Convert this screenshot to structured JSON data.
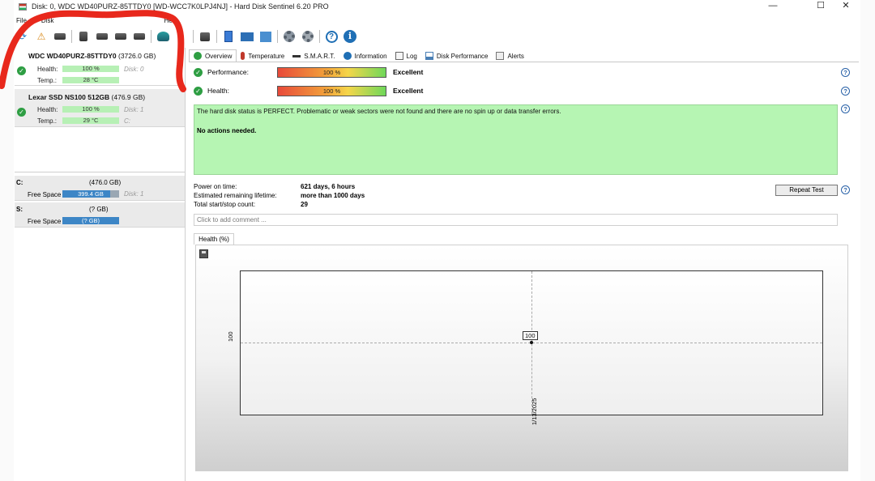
{
  "window": {
    "title": "Disk: 0, WDC WD40PURZ-85TTDY0 [WD-WCC7K0LPJ4NJ]  -  Hard Disk Sentinel 6.20 PRO",
    "minimize": "—",
    "maximize": "☐",
    "close": "✕"
  },
  "menu": [
    "File",
    "Disk",
    "Help"
  ],
  "disks": [
    {
      "name": "WDC WD40PURZ-85TTDY0",
      "size": "(3726.0 GB)",
      "health_label": "Health:",
      "health": "100 %",
      "disk_index": "Disk: 0",
      "temp_label": "Temp.:",
      "temp": "28 °C",
      "drive": ""
    },
    {
      "name": "Lexar SSD NS100 512GB",
      "size": "(476.9 GB)",
      "health_label": "Health:",
      "health": "100 %",
      "disk_index": "Disk: 1",
      "temp_label": "Temp.:",
      "temp": "29 °C",
      "drive": "C:"
    }
  ],
  "volumes": [
    {
      "letter": "C:",
      "size": "(476.0 GB)",
      "free_label": "Free Space",
      "free": "399.4 GB",
      "free_fraction": 0.84,
      "disk": "Disk: 1"
    },
    {
      "letter": "S:",
      "size": "(? GB)",
      "free_label": "Free Space",
      "free": "(? GB)",
      "free_fraction": 1.0,
      "disk": ""
    }
  ],
  "tabs": [
    {
      "label": "Overview",
      "icon": "check-icon",
      "active": true
    },
    {
      "label": "Temperature",
      "icon": "thermometer-icon",
      "active": false
    },
    {
      "label": "S.M.A.R.T.",
      "icon": "smart-icon",
      "active": false
    },
    {
      "label": "Information",
      "icon": "info-icon",
      "active": false
    },
    {
      "label": "Log",
      "icon": "log-icon",
      "active": false
    },
    {
      "label": "Disk Performance",
      "icon": "performance-icon",
      "active": false
    },
    {
      "label": "Alerts",
      "icon": "alerts-icon",
      "active": false
    }
  ],
  "overview": {
    "performance_label": "Performance:",
    "performance": "100 %",
    "performance_rating": "Excellent",
    "health_label": "Health:",
    "health": "100 %",
    "health_rating": "Excellent",
    "status_text": "The hard disk status is PERFECT. Problematic or weak sectors were not found and there are no spin up or data transfer errors.",
    "status_action": "No actions needed.",
    "power_on_label": "Power on time:",
    "power_on": "621 days, 6 hours",
    "lifetime_label": "Estimated remaining lifetime:",
    "lifetime": "more than 1000 days",
    "startstop_label": "Total start/stop count:",
    "startstop": "29",
    "repeat_test": "Repeat Test",
    "comment_placeholder": "Click to add comment ..."
  },
  "chart_data": {
    "type": "line",
    "tab_label": "Health (%)",
    "x": [
      "1/13/2025"
    ],
    "series": [
      {
        "values": [
          100
        ]
      }
    ],
    "y_tick": "100",
    "grid": true
  },
  "colors": {
    "status_bg": "#b6f5b3",
    "ok_green": "#2e9e43",
    "volume_bar": "#3d86c6",
    "annotation_red": "#e8281c"
  }
}
